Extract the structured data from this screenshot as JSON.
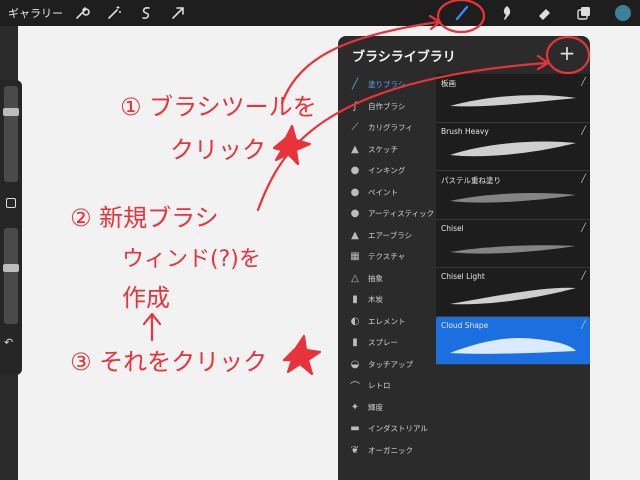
{
  "topbar": {
    "gallery_label": "ギャラリー",
    "icons": [
      "wrench-icon",
      "magic-wand-icon",
      "selection-icon",
      "transform-arrow-icon",
      "brush-icon",
      "smudge-icon",
      "eraser-icon",
      "layers-icon"
    ],
    "color_swatch": "#3f7f9a"
  },
  "panel": {
    "title": "ブラシライブラリ",
    "add_label": "+"
  },
  "categories": [
    {
      "label": "塗りブラシ",
      "icon": "pen-stroke-icon",
      "active": true
    },
    {
      "label": "自作ブラシ",
      "icon": "stroke-icon"
    },
    {
      "label": "カリグラフィ",
      "icon": "calligraphy-icon"
    },
    {
      "label": "スケッチ",
      "icon": "pencil-icon"
    },
    {
      "label": "インキング",
      "icon": "ink-drop-icon"
    },
    {
      "label": "ペイント",
      "icon": "paint-drop-icon"
    },
    {
      "label": "アーティスティック",
      "icon": "artistic-drop-icon"
    },
    {
      "label": "エアーブラシ",
      "icon": "airbrush-icon"
    },
    {
      "label": "テクスチャ",
      "icon": "texture-icon"
    },
    {
      "label": "抽象",
      "icon": "triangle-icon"
    },
    {
      "label": "木炭",
      "icon": "charcoal-icon"
    },
    {
      "label": "エレメント",
      "icon": "yin-yang-icon"
    },
    {
      "label": "スプレー",
      "icon": "spray-can-icon"
    },
    {
      "label": "タッチアップ",
      "icon": "touchup-icon"
    },
    {
      "label": "レトロ",
      "icon": "retro-icon"
    },
    {
      "label": "輝度",
      "icon": "sparkle-icon"
    },
    {
      "label": "インダストリアル",
      "icon": "anvil-icon"
    },
    {
      "label": "オーガニック",
      "icon": "leaf-icon"
    }
  ],
  "brushes": [
    {
      "name": "板画"
    },
    {
      "name": "Brush Heavy"
    },
    {
      "name": "パステル重ね塗り"
    },
    {
      "name": "Chisel"
    },
    {
      "name": "Chisel Light"
    },
    {
      "name": "Cloud Shape",
      "selected": true
    }
  ],
  "annotations": {
    "accent_color": "#e8333a",
    "step1": "① ブラシツールを",
    "step1b": "クリック",
    "step2": "② 新規ブラシ",
    "step2b": "ウィンド(?)を",
    "step2c": "作成",
    "step3": "③ それをクリック"
  }
}
